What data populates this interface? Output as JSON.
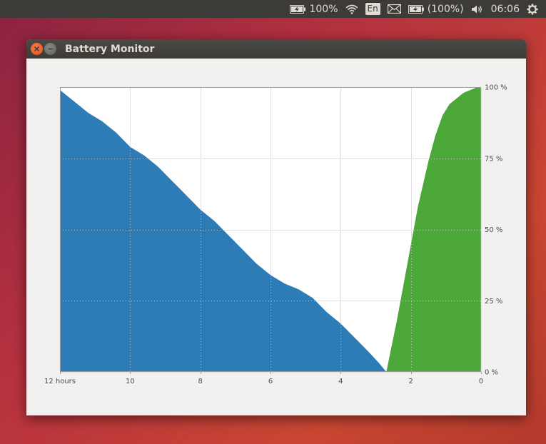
{
  "panel": {
    "battery_percent": "100%",
    "language": "En",
    "battery_paren": "(100%)",
    "clock": "06:06",
    "icons": [
      "battery-icon",
      "wifi-icon",
      "mail-icon",
      "volume-icon",
      "settings-gear-icon"
    ]
  },
  "window": {
    "title": "Battery Monitor",
    "buttons": [
      "close-icon",
      "minimize-icon"
    ]
  },
  "colors": {
    "discharge": "#2e7cb5",
    "charge": "#4ba738",
    "panel": "#3c3b37",
    "window_bg": "#f2f1f0"
  },
  "chart_data": {
    "type": "area",
    "x_ticks": [
      "12 hours",
      "10",
      "8",
      "6",
      "4",
      "2",
      "0"
    ],
    "y_ticks": [
      "0 %",
      "25 %",
      "50 %",
      "75 %",
      "100 %"
    ],
    "xlim": [
      12,
      0
    ],
    "ylim": [
      0,
      100
    ],
    "grid": true,
    "series": [
      {
        "x": [
          12,
          11.8,
          11.5,
          11.2,
          10.8,
          10.4,
          10.0,
          9.6,
          9.2,
          8.8,
          8.4,
          8.0,
          7.6,
          7.2,
          6.8,
          6.4,
          6.0,
          5.6,
          5.2,
          4.8,
          4.4,
          4.0,
          3.6,
          3.2,
          2.9,
          2.7
        ],
        "values": [
          99,
          97,
          94,
          91,
          88,
          84,
          79,
          76,
          72,
          67,
          62,
          57,
          53,
          48,
          43,
          38,
          34,
          31,
          29,
          26,
          21,
          17,
          12,
          7,
          3,
          0
        ]
      },
      {
        "x": [
          2.7,
          2.4,
          2.1,
          1.8,
          1.5,
          1.3,
          1.1,
          0.9,
          0.7,
          0.5,
          0.3,
          0.1,
          0
        ],
        "values": [
          0,
          18,
          38,
          58,
          74,
          83,
          90,
          94,
          96,
          98,
          99,
          100,
          100
        ]
      }
    ]
  }
}
